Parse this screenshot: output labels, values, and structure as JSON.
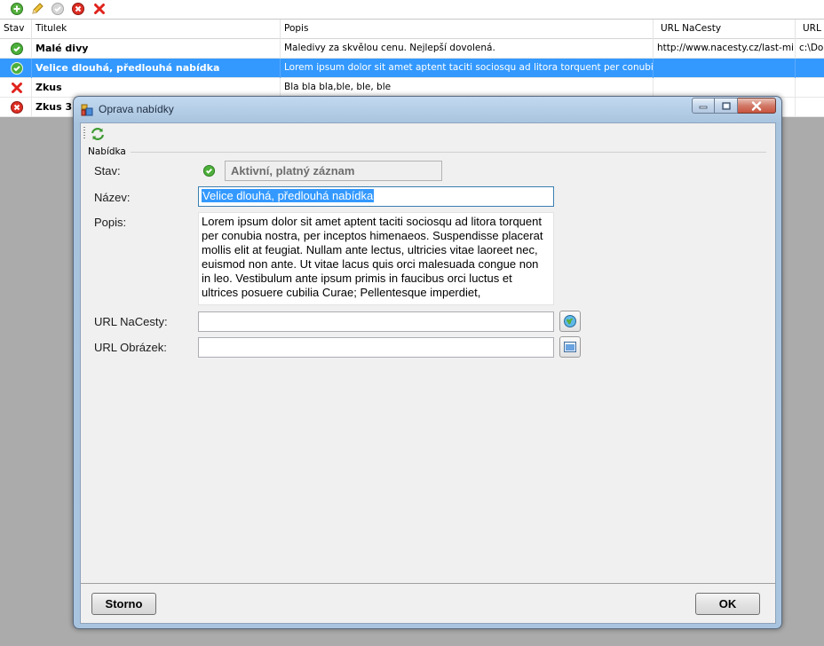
{
  "toolbar": {
    "items": [
      {
        "icon": "add-icon",
        "color": "#3a9b2a"
      },
      {
        "icon": "pencil-icon",
        "color": "#e8b227"
      },
      {
        "icon": "check-disabled-icon",
        "color": "#b8b8b8"
      },
      {
        "icon": "delete-circle-icon",
        "color": "#d52a22"
      },
      {
        "icon": "delete-x-icon",
        "color": "#e0231c"
      }
    ]
  },
  "grid": {
    "columns": [
      "Stav",
      "Titulek",
      "Popis",
      "URL NaCesty",
      "URL"
    ],
    "rows": [
      {
        "status": "ok",
        "title": "Malé divy",
        "popis": "Maledivy za skvělou cenu. Nejlepší dovolená.",
        "url": "http://www.nacesty.cz/last-mi...",
        "url2": "c:\\Do"
      },
      {
        "status": "ok",
        "title": "Velice dlouhá, předlouhá nabídka",
        "popis": "Lorem ipsum dolor sit amet aptent taciti sociosqu ad litora torquent per conubia nostra,...",
        "url": "",
        "url2": "",
        "selected": true
      },
      {
        "status": "x",
        "title": "Zkus",
        "popis": "Bla bla bla,ble, ble, ble",
        "url": "",
        "url2": ""
      },
      {
        "status": "err",
        "title": "Zkus 3",
        "popis": "",
        "url": "",
        "url2": ""
      }
    ]
  },
  "dialog": {
    "title": "Oprava nabídky",
    "group": "Nabídka",
    "labels": {
      "stav": "Stav:",
      "nazev": "Název:",
      "popis": "Popis:",
      "url_nacesty": "URL NaCesty:",
      "url_obrazek": "URL Obrázek:"
    },
    "status_value": "Aktivní, platný záznam",
    "nazev_value": "Velice dlouhá, předlouhá nabídka",
    "popis_value": "Lorem ipsum dolor sit amet aptent taciti sociosqu ad litora torquent per conubia nostra, per inceptos himenaeos. Suspendisse placerat mollis elit at feugiat. Nullam ante lectus, ultricies vitae laoreet nec, euismod non ante. Ut vitae lacus quis orci malesuada congue non in leo. Vestibulum ante ipsum primis in faucibus orci luctus et ultrices posuere cubilia Curae; Pellentesque imperdiet,",
    "url_nacesty_value": "",
    "url_obrazek_value": "",
    "buttons": {
      "cancel": "Storno",
      "ok": "OK"
    }
  },
  "colors": {
    "selection": "#3399ff",
    "ok_green": "#4caf3a",
    "error_red": "#d52a22"
  }
}
